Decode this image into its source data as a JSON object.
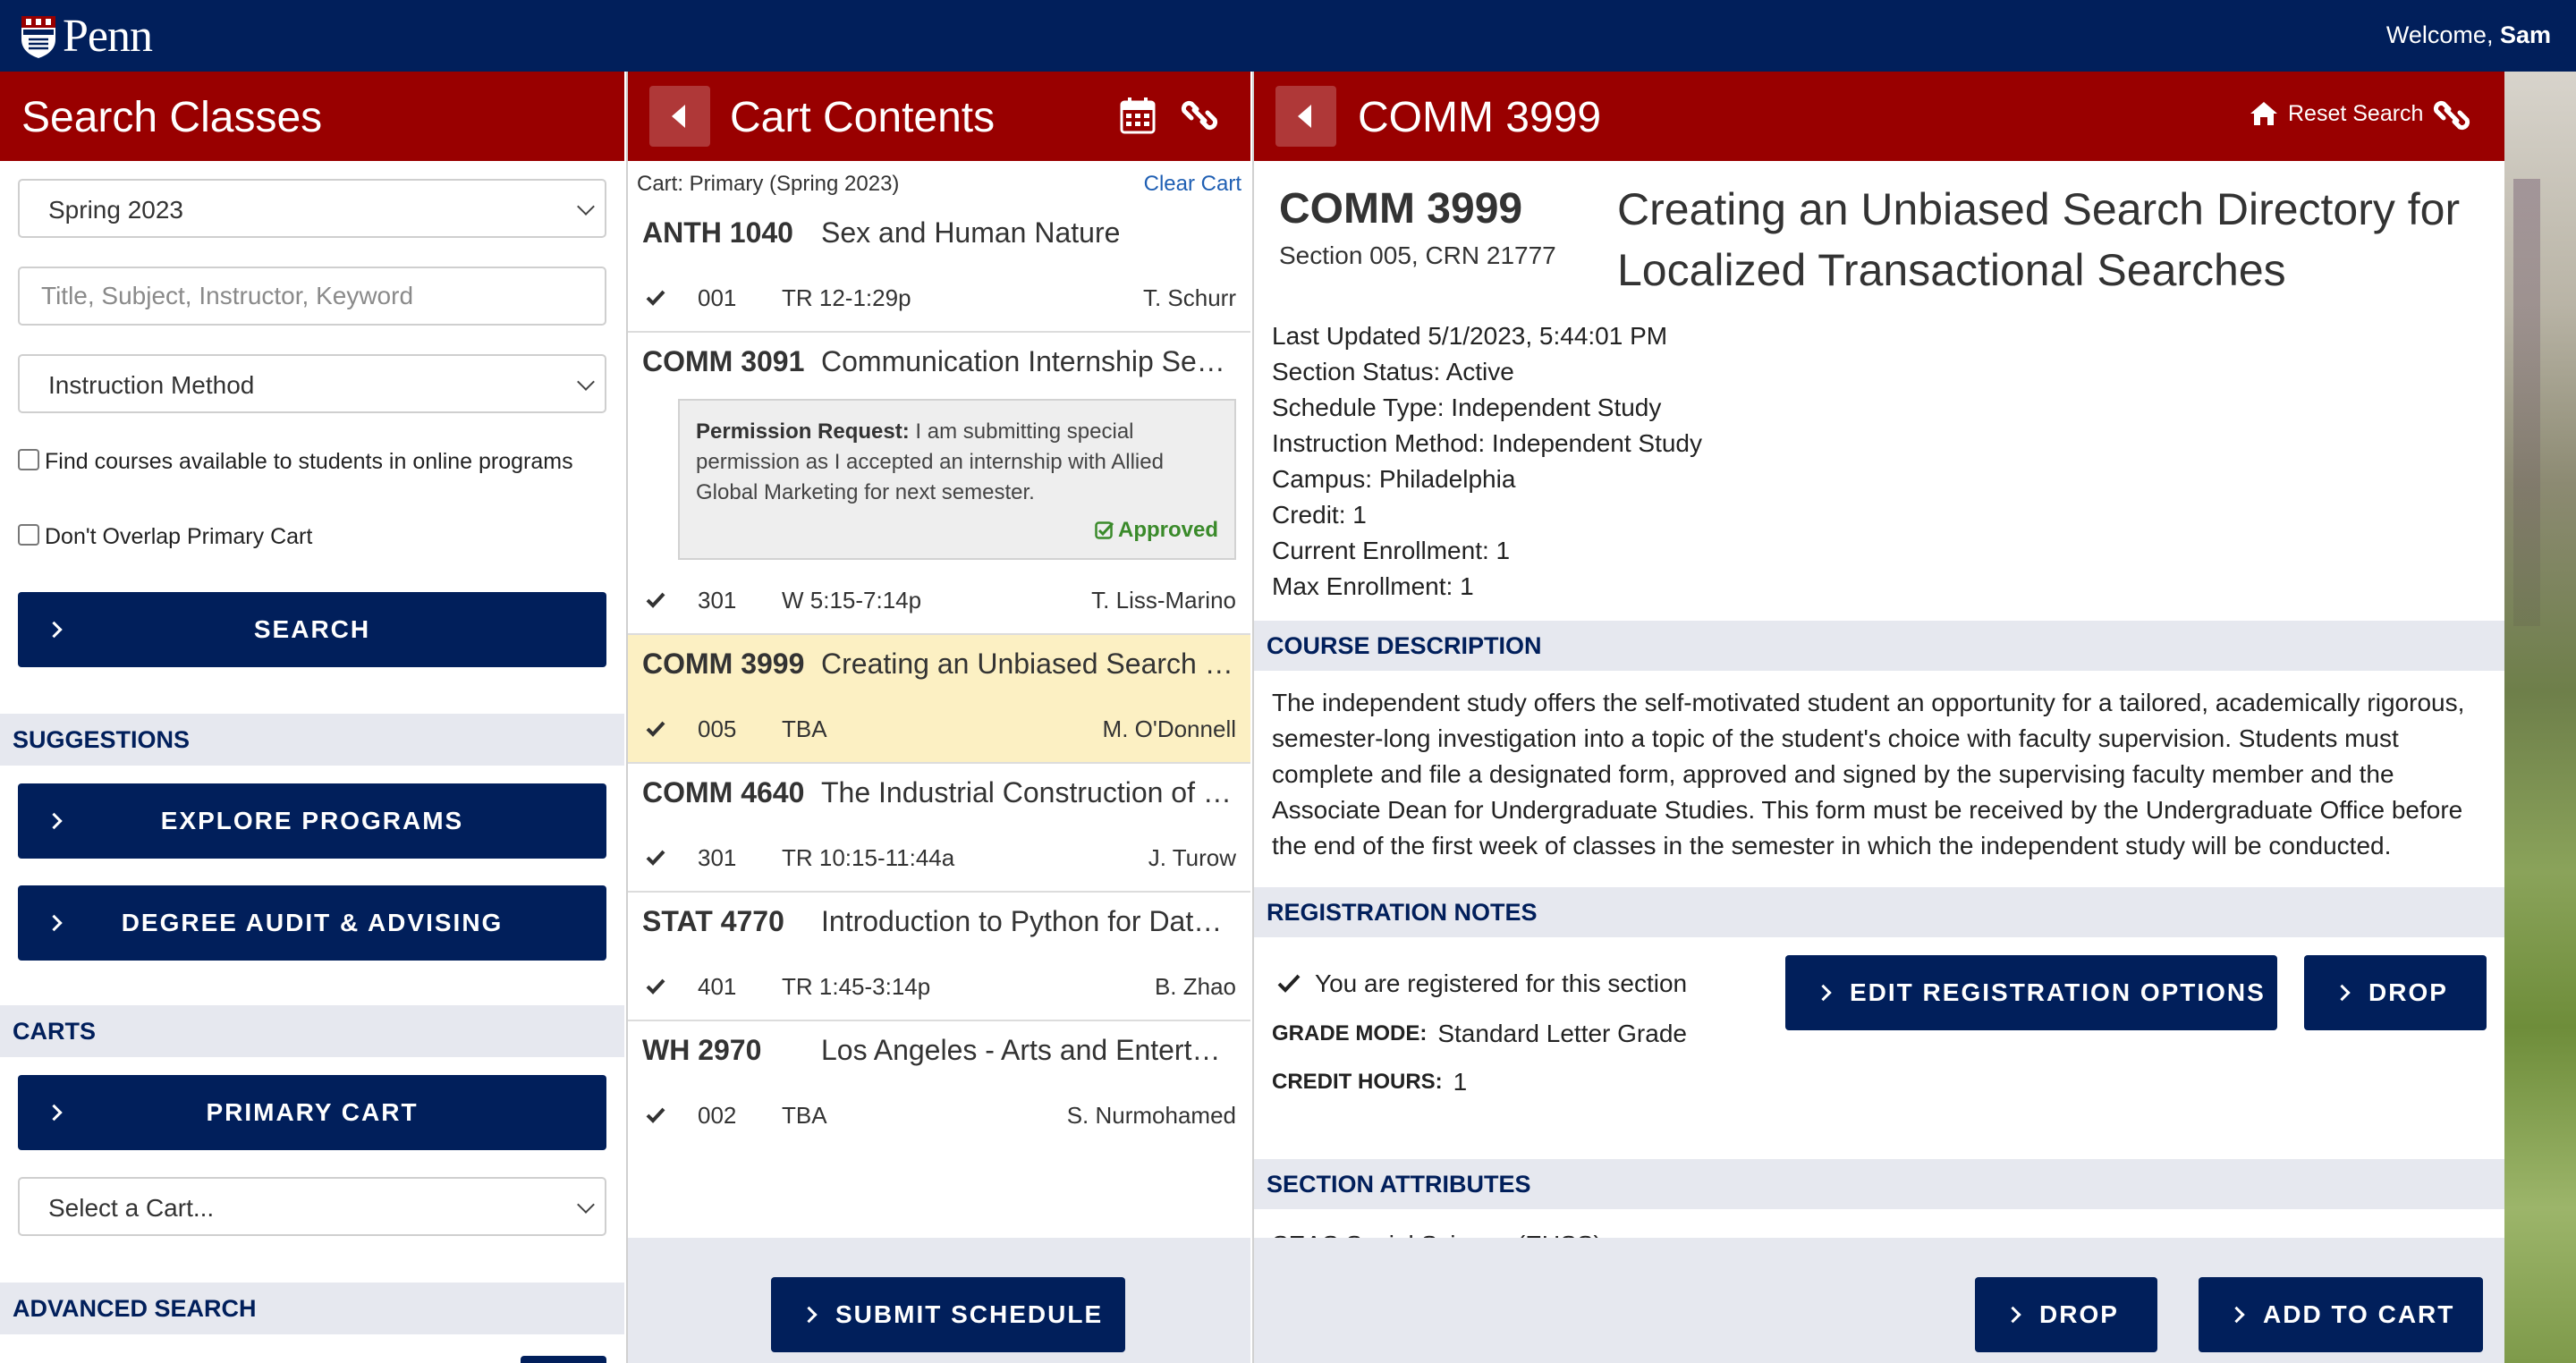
{
  "header": {
    "logo_text": "Penn",
    "welcome_prefix": "Welcome, ",
    "user_name": "Sam"
  },
  "search": {
    "title": "Search Classes",
    "term": "Spring 2023",
    "keyword_placeholder": "Title, Subject, Instructor, Keyword",
    "instruction_method": "Instruction Method",
    "online_programs_label": "Find courses available to students in online programs",
    "no_overlap_label": "Don't Overlap Primary Cart",
    "search_button": "SEARCH",
    "suggestions_heading": "SUGGESTIONS",
    "explore_button": "EXPLORE PROGRAMS",
    "degree_audit_button": "DEGREE AUDIT & ADVISING",
    "carts_heading": "CARTS",
    "primary_cart_button": "PRIMARY CART",
    "select_cart": "Select a Cart...",
    "advanced_heading": "ADVANCED SEARCH"
  },
  "cart": {
    "title": "Cart Contents",
    "cart_label": "Cart: Primary (Spring 2023)",
    "clear_label": "Clear Cart",
    "submit_button": "SUBMIT SCHEDULE",
    "items": [
      {
        "code": "ANTH 1040",
        "title": "Sex and Human Nature",
        "section": "001",
        "time": "TR 12-1:29p",
        "instructor": "T. Schurr"
      },
      {
        "code": "COMM 3091",
        "title": "Communication Internship Seminar",
        "perm_label": "Permission Request:",
        "perm_text": " I am submitting special permission as I accepted an internship with Allied Global Marketing for next semester.",
        "perm_status": "Approved",
        "section": "301",
        "time": "W 5:15-7:14p",
        "instructor": "T. Liss-Marino"
      },
      {
        "code": "COMM 3999",
        "title": "Creating an Unbiased Search Directory",
        "section": "005",
        "time": "TBA",
        "instructor": "M. O'Donnell"
      },
      {
        "code": "COMM 4640",
        "title": "The Industrial Construction of Media",
        "section": "301",
        "time": "TR 10:15-11:44a",
        "instructor": "J. Turow"
      },
      {
        "code": "STAT 4770",
        "title": "Introduction to Python for Data Science",
        "section": "401",
        "time": "TR 1:45-3:14p",
        "instructor": "B. Zhao"
      },
      {
        "code": "WH 2970",
        "title": "Los Angeles - Arts and Entertainment",
        "section": "002",
        "time": "TBA",
        "instructor": "S. Nurmohamed"
      }
    ]
  },
  "detail": {
    "header_title": "COMM 3999",
    "reset_label": "Reset Search",
    "code": "COMM 3999",
    "section_crn": "Section 005, CRN 21777",
    "title": "Creating an Unbiased Search Directory for Localized Transactional Searches",
    "info": [
      "Last Updated 5/1/2023, 5:44:01 PM",
      "Section Status: Active",
      "Schedule Type: Independent Study",
      "Instruction Method: Independent Study",
      "Campus: Philadelphia",
      "Credit: 1",
      "Current Enrollment: 1",
      "Max Enrollment: 1"
    ],
    "desc_heading": "COURSE DESCRIPTION",
    "description": "The independent study offers the self-motivated student an opportunity for a tailored, academically rigorous, semester-long investigation into a topic of the student's choice with faculty supervision. Students must complete and file a designated form, approved and signed by the supervising faculty member and the Associate Dean for Undergraduate Studies. This form must be received by the Undergraduate Office before the end of the first week of classes in the semester in which the independent study will be conducted.",
    "reg_heading": "REGISTRATION NOTES",
    "registered_text": "You are registered for this section",
    "grade_mode_label": "GRADE MODE:",
    "grade_mode_value": "Standard Letter Grade",
    "credit_hours_label": "CREDIT HOURS:",
    "credit_hours_value": "1",
    "edit_button": "EDIT REGISTRATION OPTIONS",
    "drop_button": "DROP",
    "attr_heading": "SECTION ATTRIBUTES",
    "attr_partial": "SEAS Social Science (EUSS)",
    "footer_drop": "DROP",
    "footer_add": "ADD TO CART"
  },
  "colors": {
    "navy": "#011f5b",
    "red": "#990000",
    "highlight": "#fcf0c3",
    "approved": "#3a8a2a",
    "link": "#1f5fb3"
  }
}
